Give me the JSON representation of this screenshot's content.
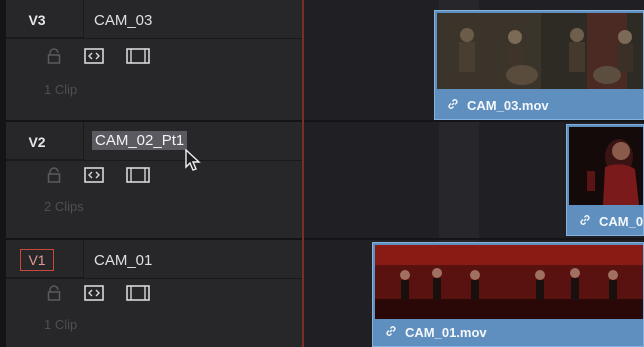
{
  "tracks": [
    {
      "id": "V3",
      "name": "CAM_03",
      "clips": "1 Clip"
    },
    {
      "id": "V2",
      "name": "CAM_02_Pt1",
      "clips": "2 Clips"
    },
    {
      "id": "V1",
      "name": "CAM_01",
      "clips": "1 Clip"
    }
  ],
  "timeline_clips": {
    "cam03": "CAM_03.mov",
    "cam02": "CAM_0",
    "cam01": "CAM_01.mov"
  },
  "icons": {
    "lock": "lock-icon",
    "auto_select": "auto-select-icon",
    "disable_video": "film-icon",
    "link": "link-icon",
    "cursor": "mouse-cursor-icon"
  },
  "colors": {
    "clip_blue": "#5e8fbe",
    "active_track_outline": "#c8493b"
  }
}
